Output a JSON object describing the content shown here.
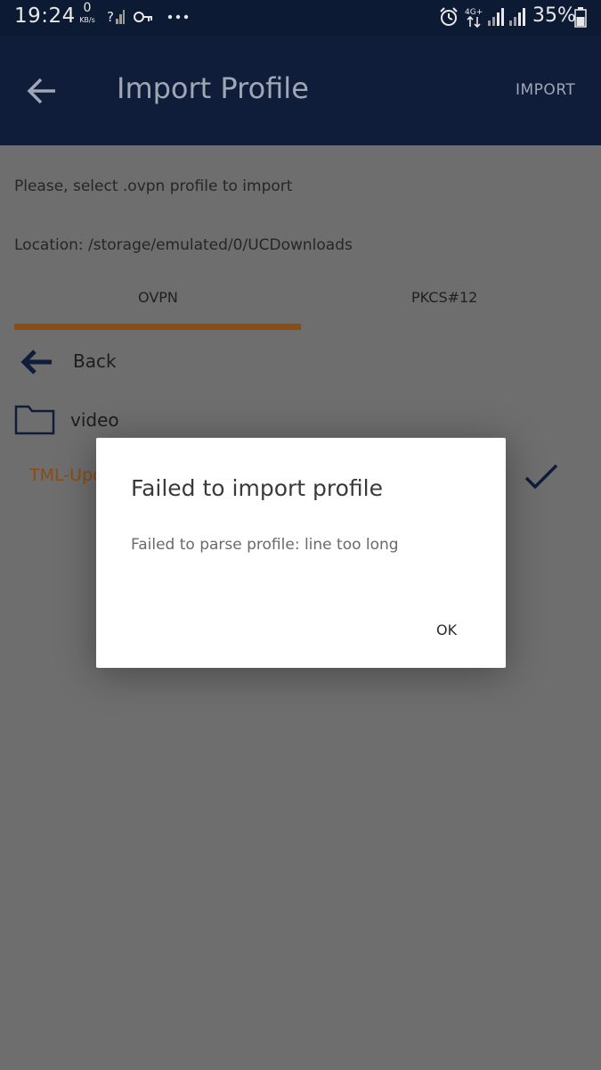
{
  "status_bar": {
    "time": "19:24",
    "net_speed_value": "0",
    "net_speed_unit": "KB/s",
    "battery_percent": "35%",
    "icons": [
      "no-signal-icon",
      "vpn-key-icon",
      "more-dots-icon",
      "alarm-icon",
      "4g-data-icon",
      "signal-icon",
      "signal-icon",
      "battery-icon"
    ]
  },
  "app_bar": {
    "title": "Import Profile",
    "action_label": "IMPORT"
  },
  "content": {
    "instruction": "Please, select .ovpn profile to import",
    "location": "Location: /storage/emulated/0/UCDownloads",
    "tabs": [
      {
        "label": "OVPN",
        "selected": true
      },
      {
        "label": "PKCS#12",
        "selected": false
      }
    ],
    "rows": {
      "back_label": "Back",
      "folder_label": "video",
      "file_label": "TML-Upc"
    }
  },
  "dialog": {
    "title": "Failed to import profile",
    "message": "Failed to parse profile: line too long",
    "ok_label": "OK"
  },
  "colors": {
    "app_bar": "#0f1d3a",
    "accent": "#8a4c12",
    "overlay_bg": "#6e6e6e",
    "dialog_bg": "#ffffff"
  }
}
